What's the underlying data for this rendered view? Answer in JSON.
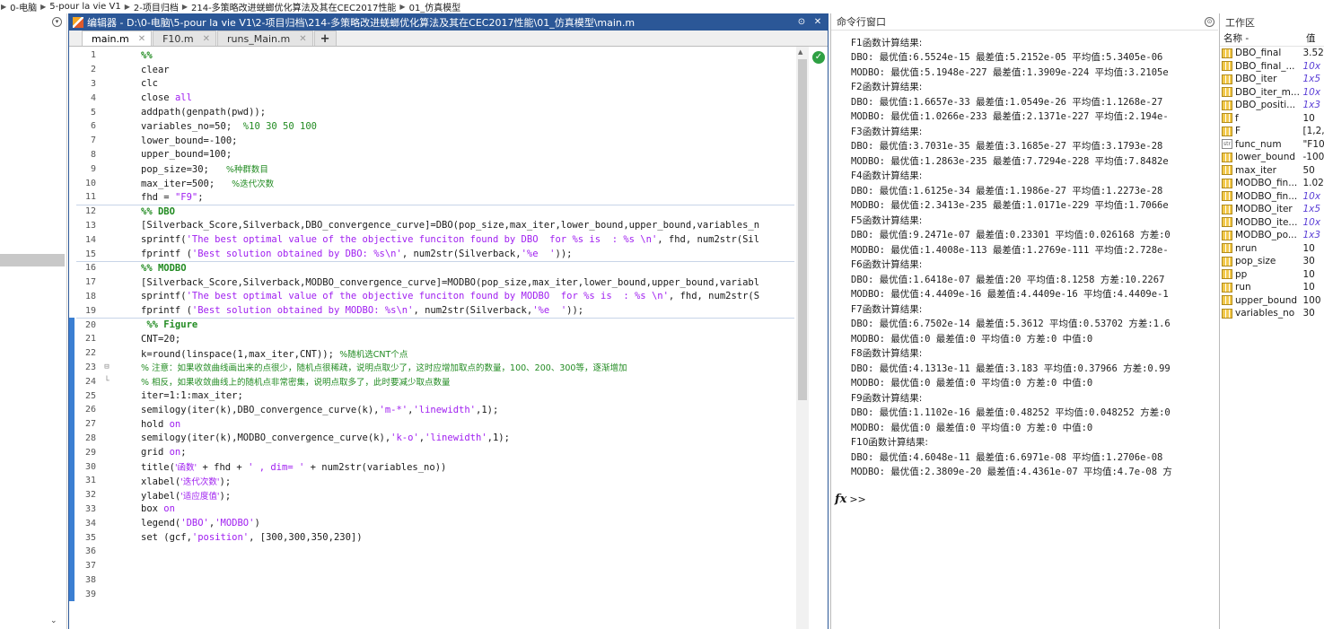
{
  "breadcrumb": [
    "0-电脑",
    "5-pour la vie V1",
    "2-项目归档",
    "214-多策略改进蜣螂优化算法及其在CEC2017性能",
    "01_仿真模型"
  ],
  "editor": {
    "title": "编辑器 - D:\\0-电脑\\5-pour la vie V1\\2-项目归档\\214-多策略改进蜣螂优化算法及其在CEC2017性能\\01_仿真模型\\main.m",
    "title_buttons": [
      "⊙",
      "✕"
    ],
    "tabs": [
      {
        "label": "main.m",
        "active": true
      },
      {
        "label": "F10.m",
        "active": false
      },
      {
        "label": "runs_Main.m",
        "active": false
      }
    ],
    "add_tab": "+",
    "lines": [
      [
        [
          "cell",
          "%%"
        ]
      ],
      [
        [
          "",
          "clear"
        ]
      ],
      [
        [
          "",
          "clc"
        ]
      ],
      [
        [
          "",
          "close "
        ],
        [
          "str",
          "all"
        ]
      ],
      [
        [
          "",
          "addpath(genpath(pwd));"
        ]
      ],
      [
        [
          "",
          "variables_no=50;  "
        ],
        [
          "cm",
          "%10 30 50 100"
        ]
      ],
      [
        [
          "",
          "lower_bound=-100;"
        ]
      ],
      [
        [
          "",
          "upper_bound=100;"
        ]
      ],
      [
        [
          "",
          "pop_size=30;   "
        ],
        [
          "cm",
          "%种群数目"
        ]
      ],
      [
        [
          "",
          "max_iter=500;   "
        ],
        [
          "cm",
          "%迭代次数"
        ]
      ],
      [
        [
          "",
          "fhd = "
        ],
        [
          "str",
          "\"F9\""
        ],
        [
          "",
          ";"
        ]
      ],
      [
        [
          "cell",
          "%% DBO"
        ]
      ],
      [
        [
          "",
          "[Silverback_Score,Silverback,DBO_convergence_curve]=DBO(pop_size,max_iter,lower_bound,upper_bound,variables_n"
        ]
      ],
      [
        [
          "",
          "sprintf("
        ],
        [
          "str",
          "'The best optimal value of the objective funciton found by DBO  for %s is  : %s \\n'"
        ],
        [
          "",
          ", fhd, num2str(Sil"
        ]
      ],
      [
        [
          "",
          "fprintf ("
        ],
        [
          "str",
          "'Best solution obtained by DBO: %s\\n'"
        ],
        [
          "",
          ", num2str(Silverback,"
        ],
        [
          "str",
          "'%e  '"
        ],
        [
          "",
          "));"
        ]
      ],
      [
        [
          "cell",
          "%% MODBO"
        ]
      ],
      [
        [
          "",
          "[Silverback_Score,Silverback,MODBO_convergence_curve]=MODBO(pop_size,max_iter,lower_bound,upper_bound,variabl"
        ]
      ],
      [
        [
          "",
          "sprintf("
        ],
        [
          "str",
          "'The best optimal value of the objective funciton found by MODBO  for %s is  : %s \\n'"
        ],
        [
          "",
          ", fhd, num2str(S"
        ]
      ],
      [
        [
          "",
          "fprintf ("
        ],
        [
          "str",
          "'Best solution obtained by MODBO: %s\\n'"
        ],
        [
          "",
          ", num2str(Silverback,"
        ],
        [
          "str",
          "'%e  '"
        ],
        [
          "",
          "));"
        ]
      ],
      [
        [
          "cell",
          " %% Figure"
        ]
      ],
      [
        [
          "",
          "CNT=20;"
        ]
      ],
      [
        [
          "",
          "k=round(linspace(1,max_iter,CNT)); "
        ],
        [
          "cm",
          "%随机选CNT个点"
        ]
      ],
      [
        [
          "cm",
          "% 注意：如果收敛曲线画出来的点很少，随机点很稀疏，说明点取少了，这时应增加取点的数量，100、200、300等，逐渐增加"
        ]
      ],
      [
        [
          "cm",
          "% 相反，如果收敛曲线上的随机点非常密集，说明点取多了，此时要减少取点数量"
        ]
      ],
      [
        [
          "",
          "iter=1:1:max_iter;"
        ]
      ],
      [
        [
          "",
          "semilogy(iter(k),DBO_convergence_curve(k),"
        ],
        [
          "str",
          "'m-*'"
        ],
        [
          "",
          ","
        ],
        [
          "str",
          "'linewidth'"
        ],
        [
          "",
          ",1);"
        ]
      ],
      [
        [
          "",
          "hold "
        ],
        [
          "str",
          "on"
        ]
      ],
      [
        [
          "",
          "semilogy(iter(k),MODBO_convergence_curve(k),"
        ],
        [
          "str",
          "'k-o'"
        ],
        [
          "",
          ","
        ],
        [
          "str",
          "'linewidth'"
        ],
        [
          "",
          ",1);"
        ]
      ],
      [
        [
          "",
          "grid "
        ],
        [
          "str",
          "on"
        ],
        [
          "",
          ";"
        ]
      ],
      [
        [
          "",
          "title("
        ],
        [
          "str",
          "'函数'"
        ],
        [
          "",
          " + fhd + "
        ],
        [
          "str",
          "' , dim= '"
        ],
        [
          "",
          " + num2str(variables_no))"
        ]
      ],
      [
        [
          "",
          "xlabel("
        ],
        [
          "str",
          "'迭代次数'"
        ],
        [
          "",
          ");"
        ]
      ],
      [
        [
          "",
          "ylabel("
        ],
        [
          "str",
          "'适应度值'"
        ],
        [
          "",
          ");"
        ]
      ],
      [
        [
          "",
          "box "
        ],
        [
          "str",
          "on"
        ]
      ],
      [
        [
          "",
          "legend("
        ],
        [
          "str",
          "'DBO'"
        ],
        [
          "",
          ","
        ],
        [
          "str",
          "'MODBO'"
        ],
        [
          "",
          ")"
        ]
      ],
      [
        [
          "",
          "set (gcf,"
        ],
        [
          "str",
          "'position'"
        ],
        [
          "",
          ", [300,300,350,230])"
        ]
      ],
      [
        [
          "",
          ""
        ]
      ],
      [
        [
          "",
          ""
        ]
      ],
      [
        [
          "",
          ""
        ]
      ],
      [
        [
          "",
          ""
        ]
      ]
    ]
  },
  "command_window": {
    "title": "命令行窗口",
    "title_button": "⊙",
    "lines": [
      "F1函数计算结果:",
      "DBO: 最优值:6.5524e-15 最差值:5.2152e-05 平均值:5.3405e-06",
      "MODBO: 最优值:5.1948e-227 最差值:1.3909e-224 平均值:3.2105e",
      "F2函数计算结果:",
      "DBO: 最优值:1.6657e-33 最差值:1.0549e-26 平均值:1.1268e-27",
      "MODBO: 最优值:1.0266e-233 最差值:2.1371e-227 平均值:2.194e-",
      "F3函数计算结果:",
      "DBO: 最优值:3.7031e-35 最差值:3.1685e-27 平均值:3.1793e-28",
      "MODBO: 最优值:1.2863e-235 最差值:7.7294e-228 平均值:7.8482e",
      "F4函数计算结果:",
      "DBO: 最优值:1.6125e-34 最差值:1.1986e-27 平均值:1.2273e-28",
      "MODBO: 最优值:2.3413e-235 最差值:1.0171e-229 平均值:1.7066e",
      "F5函数计算结果:",
      "DBO: 最优值:9.2471e-07 最差值:0.23301 平均值:0.026168 方差:0",
      "MODBO: 最优值:1.4008e-113 最差值:1.2769e-111 平均值:2.728e-",
      "F6函数计算结果:",
      "DBO: 最优值:1.6418e-07 最差值:20 平均值:8.1258 方差:10.2267",
      "MODBO: 最优值:4.4409e-16 最差值:4.4409e-16 平均值:4.4409e-1",
      "F7函数计算结果:",
      "DBO: 最优值:6.7502e-14 最差值:5.3612 平均值:0.53702 方差:1.6",
      "MODBO: 最优值:0 最差值:0 平均值:0 方差:0 中值:0",
      "F8函数计算结果:",
      "DBO: 最优值:4.1313e-11 最差值:3.183 平均值:0.37966 方差:0.99",
      "MODBO: 最优值:0 最差值:0 平均值:0 方差:0 中值:0",
      "F9函数计算结果:",
      "DBO: 最优值:1.1102e-16 最差值:0.48252 平均值:0.048252 方差:0",
      "MODBO: 最优值:0 最差值:0 平均值:0 方差:0 中值:0",
      "F10函数计算结果:",
      "DBO: 最优值:4.6048e-11 最差值:6.6971e-08 平均值:1.2706e-08",
      "MODBO: 最优值:2.3809e-20 最差值:4.4361e-07 平均值:4.7e-08 方"
    ],
    "prompt_fx": "fx",
    "prompt": ">>"
  },
  "workspace": {
    "title": "工作区",
    "col_name": "名称 -",
    "col_value": "值",
    "vars": [
      {
        "name": "DBO_final",
        "value": "3.52",
        "italic": false,
        "type": "mat"
      },
      {
        "name": "DBO_final_...",
        "value": "10x",
        "italic": true,
        "type": "mat"
      },
      {
        "name": "DBO_iter",
        "value": "1x5",
        "italic": true,
        "type": "mat"
      },
      {
        "name": "DBO_iter_m...",
        "value": "10x",
        "italic": true,
        "type": "mat"
      },
      {
        "name": "DBO_positi...",
        "value": "1x3",
        "italic": true,
        "type": "mat"
      },
      {
        "name": "f",
        "value": "10",
        "italic": false,
        "type": "mat"
      },
      {
        "name": "F",
        "value": "[1,2,",
        "italic": false,
        "type": "mat"
      },
      {
        "name": "func_num",
        "value": "\"F10",
        "italic": false,
        "type": "txt"
      },
      {
        "name": "lower_bound",
        "value": "-100",
        "italic": false,
        "type": "mat"
      },
      {
        "name": "max_iter",
        "value": "50",
        "italic": false,
        "type": "mat"
      },
      {
        "name": "MODBO_fin...",
        "value": "1.02",
        "italic": false,
        "type": "mat"
      },
      {
        "name": "MODBO_fin...",
        "value": "10x",
        "italic": true,
        "type": "mat"
      },
      {
        "name": "MODBO_iter",
        "value": "1x5",
        "italic": true,
        "type": "mat"
      },
      {
        "name": "MODBO_ite...",
        "value": "10x",
        "italic": true,
        "type": "mat"
      },
      {
        "name": "MODBO_po...",
        "value": "1x3",
        "italic": true,
        "type": "mat"
      },
      {
        "name": "nrun",
        "value": "10",
        "italic": false,
        "type": "mat"
      },
      {
        "name": "pop_size",
        "value": "30",
        "italic": false,
        "type": "mat"
      },
      {
        "name": "pp",
        "value": "10",
        "italic": false,
        "type": "mat"
      },
      {
        "name": "run",
        "value": "10",
        "italic": false,
        "type": "mat"
      },
      {
        "name": "upper_bound",
        "value": "100",
        "italic": false,
        "type": "mat"
      },
      {
        "name": "variables_no",
        "value": "30",
        "italic": false,
        "type": "mat"
      }
    ]
  },
  "colors": {
    "editor_title_bg": "#2b5797",
    "keyword_string": "#a020f0",
    "comment": "#228b22",
    "cell_marker_bar": "#3b7fd2"
  },
  "icons": [
    "editor-icon",
    "close-icon",
    "undock-icon",
    "check-icon",
    "variable-icon",
    "fx-icon"
  ]
}
